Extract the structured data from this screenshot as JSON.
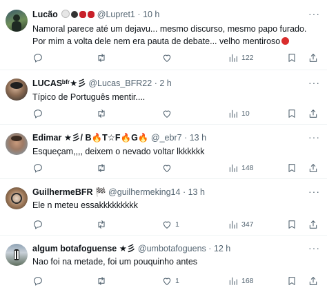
{
  "tweets": [
    {
      "name": "Lucão",
      "name_emoji": "⚪⚫🥊🥊",
      "handle": "@Lupret1",
      "time": "10 h",
      "text": "Namoral parece até um dejavu... mesmo discurso, mesmo papo furado. Por mim a volta dele nem era pauta de debate... velho mentiroso",
      "text_emoji": "😡",
      "stats": {
        "replies": "",
        "retweets": "",
        "likes": "",
        "views": "122"
      }
    },
    {
      "name": "LUCASᵇᶠʳ★彡",
      "name_emoji": "",
      "handle": "@Lucas_BFR22",
      "time": "2 h",
      "text": "Típico de Português mentir....",
      "text_emoji": "",
      "stats": {
        "replies": "",
        "retweets": "",
        "likes": "",
        "views": "10"
      }
    },
    {
      "name": "Edimar ★彡/ B🔥T☆F🔥G🔥",
      "name_emoji": "",
      "handle": "@_ebr7",
      "time": "13 h",
      "text": "Esqueçam,,,, deixem o nevado voltar lkkkkkk",
      "text_emoji": "",
      "stats": {
        "replies": "",
        "retweets": "",
        "likes": "",
        "views": "148"
      }
    },
    {
      "name": "GuilhermeBFR 🏁",
      "name_emoji": "",
      "handle": "@guilhermeking14",
      "time": "13 h",
      "text": "Ele n meteu essakkkkkkkkk",
      "text_emoji": "",
      "stats": {
        "replies": "",
        "retweets": "",
        "likes": "1",
        "views": "347"
      }
    },
    {
      "name": "algum botafoguense ★彡",
      "name_emoji": "",
      "handle": "@umbotafoguens",
      "time": "12 h",
      "text": "Nao foi na metade, foi um pouquinho antes",
      "text_emoji": "",
      "stats": {
        "replies": "",
        "retweets": "",
        "likes": "1",
        "views": "168"
      }
    }
  ],
  "icons": {
    "reply": "reply-icon",
    "retweet": "retweet-icon",
    "like": "heart-icon",
    "views": "views-icon",
    "bookmark": "bookmark-icon",
    "share": "share-icon",
    "more": "more-icon"
  },
  "colors": {
    "text": "#0f1419",
    "muted": "#536471",
    "divider": "#eff3f4"
  }
}
